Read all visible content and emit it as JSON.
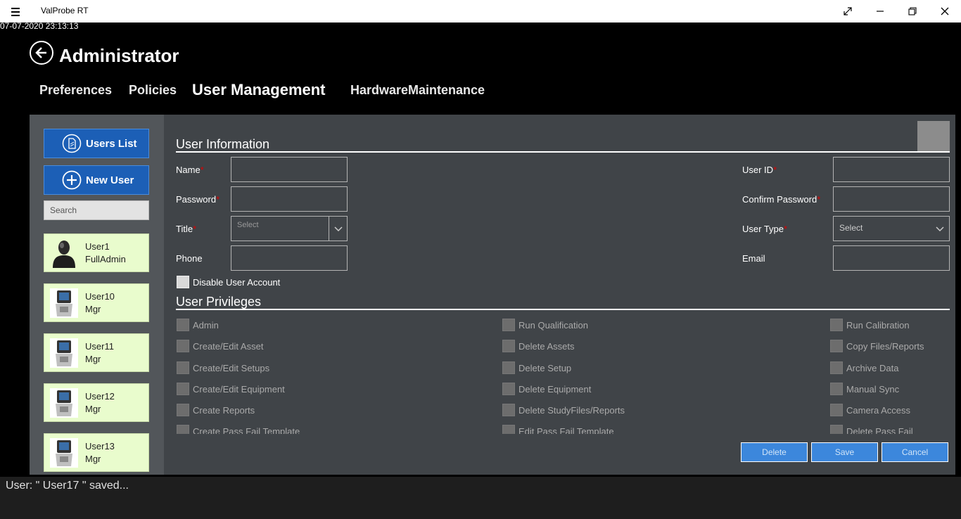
{
  "window": {
    "app_title": "ValProbe RT",
    "timestamp": "07-07-2020 23:13:13"
  },
  "header": {
    "title": "Administrator"
  },
  "tabs": [
    {
      "label": "Preferences",
      "active": false
    },
    {
      "label": "Policies",
      "active": false
    },
    {
      "label": "User Management",
      "active": true
    },
    {
      "label": "HardwareMaintenance",
      "active": false
    }
  ],
  "sidebar": {
    "users_list_label": "Users List",
    "new_user_label": "New User",
    "search_placeholder": "Search",
    "users": [
      {
        "name": "User1",
        "role": "FullAdmin",
        "avatar": "person-silhouette"
      },
      {
        "name": "User10",
        "role": "Mgr",
        "avatar": "device-image"
      },
      {
        "name": "User11",
        "role": "Mgr",
        "avatar": "device-image"
      },
      {
        "name": "User12",
        "role": "Mgr",
        "avatar": "device-image"
      },
      {
        "name": "User13",
        "role": "Mgr",
        "avatar": "device-image"
      }
    ]
  },
  "user_info": {
    "section_title": "User Information",
    "name_label": "Name",
    "password_label": "Password",
    "title_label": "Title",
    "title_placeholder": "Select",
    "phone_label": "Phone",
    "user_id_label": "User ID",
    "confirm_password_label": "Confirm Password",
    "user_type_label": "User Type",
    "user_type_placeholder": "Select",
    "email_label": "Email",
    "required_marker": "*",
    "disable_account_label": "Disable User Account"
  },
  "privileges": {
    "section_title": "User Privileges",
    "col1": [
      "Admin",
      "Create/Edit Asset",
      "Create/Edit Setups",
      "Create/Edit Equipment",
      "Create Reports",
      "Create Pass Fail Template"
    ],
    "col2": [
      "Run Qualification",
      "Delete Assets",
      "Delete Setup",
      "Delete Equipment",
      "Delete StudyFiles/Reports",
      "Edit Pass Fail Template"
    ],
    "col3": [
      "Run Calibration",
      "Copy Files/Reports",
      "Archive Data",
      "Manual Sync",
      "Camera Access",
      "Delete Pass Fail Template"
    ]
  },
  "actions": {
    "delete_label": "Delete",
    "save_label": "Save",
    "cancel_label": "Cancel"
  },
  "status": {
    "message": "User: \" User17 \" saved..."
  },
  "colors": {
    "accent_blue": "#1c5fb6",
    "action_blue": "#3c87dc",
    "user_card_bg": "#e9fccd",
    "required": "#dd0000"
  }
}
